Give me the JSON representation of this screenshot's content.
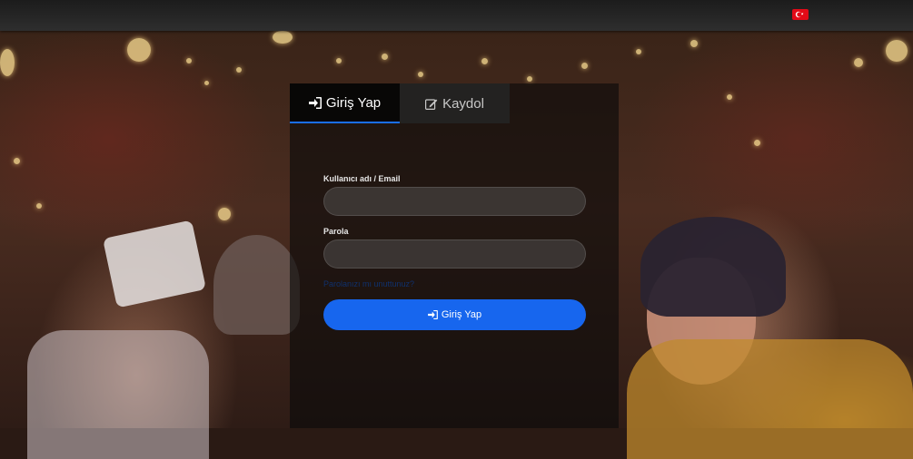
{
  "topbar": {
    "language_flag": "turkey-flag-icon",
    "flag_color": "#e30a17"
  },
  "tabs": [
    {
      "label": "Giriş Yap",
      "icon": "sign-in-icon",
      "active": true
    },
    {
      "label": "Kaydol",
      "icon": "edit-icon",
      "active": false
    }
  ],
  "form": {
    "username_label": "Kullanıcı adı / Email",
    "username_value": "",
    "password_label": "Parola",
    "password_value": "",
    "forgot_link": "Parolanızı mı unuttunuz?",
    "submit_label": "Giriş Yap",
    "submit_icon": "sign-in-icon"
  },
  "colors": {
    "accent": "#1766ee",
    "panel_bg": "rgba(10,10,10,0.62)"
  }
}
